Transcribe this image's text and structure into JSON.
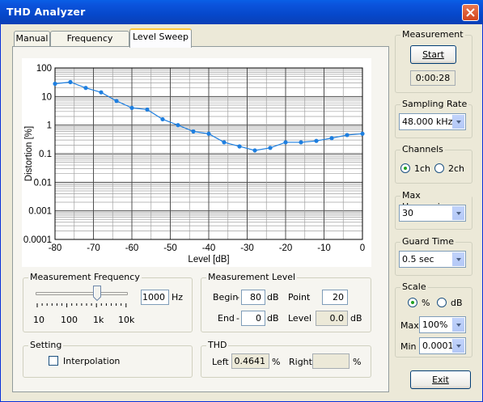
{
  "window": {
    "title": "THD Analyzer"
  },
  "tabs": [
    {
      "label": "Manual",
      "active": false
    },
    {
      "label": "Frequency Sweep",
      "active": false
    },
    {
      "label": "Level Sweep",
      "active": true
    }
  ],
  "chart_data": {
    "type": "line",
    "xlabel": "Level [dB]",
    "ylabel": "Distortion [%]",
    "xlim": [
      -80,
      0
    ],
    "ylim": [
      0.0001,
      100
    ],
    "yscale": "log",
    "grid": true,
    "x_ticks": [
      "-80",
      "-70",
      "-60",
      "-50",
      "-40",
      "-30",
      "-20",
      "-10",
      "0"
    ],
    "y_ticks": [
      "100",
      "10",
      "1",
      "0.1",
      "0.01",
      "0.001",
      "0.0001"
    ],
    "color": "#1e7fe0",
    "series": [
      {
        "x": [
          -80,
          -76,
          -72,
          -68,
          -64,
          -60,
          -56,
          -52,
          -48,
          -44,
          -40,
          -36,
          -32,
          -28,
          -24,
          -20,
          -16,
          -12,
          -8,
          -4,
          0
        ],
        "y": [
          28,
          32,
          20,
          14,
          7,
          4,
          3.5,
          1.6,
          1.0,
          0.6,
          0.5,
          0.25,
          0.18,
          0.13,
          0.16,
          0.25,
          0.25,
          0.28,
          0.35,
          0.45,
          0.5
        ]
      }
    ]
  },
  "measurement_frequency": {
    "label": "Measurement Frequency",
    "value": "1000",
    "unit": "Hz",
    "slider_ticks": [
      "10",
      "100",
      "1k",
      "10k"
    ]
  },
  "measurement_level": {
    "label": "Measurement Level",
    "begin_label": "Begin",
    "begin_value": "80",
    "end_label": "End",
    "end_value": "0",
    "db_unit": "dB",
    "point_label": "Point",
    "point_value": "20",
    "level_label": "Level",
    "level_value": "0.0",
    "level_unit": "dB",
    "minus": "-"
  },
  "setting": {
    "label": "Setting",
    "interpolation_label": "Interpolation",
    "interpolation_checked": false
  },
  "thd": {
    "label": "THD",
    "left_label": "Left",
    "left_value": "0.4641",
    "right_label": "Right",
    "right_value": "",
    "unit": "%"
  },
  "measurement": {
    "label": "Measurement",
    "start_label": "Start",
    "elapsed": "0:00:28"
  },
  "sampling_rate": {
    "label": "Sampling Rate",
    "value": "48.000 kHz"
  },
  "channels": {
    "label": "Channels",
    "options": [
      "1ch",
      "2ch"
    ],
    "selected": "1ch"
  },
  "max_harmonics": {
    "label": "Max Harmonics",
    "value": "30"
  },
  "guard_time": {
    "label": "Guard Time",
    "value": "0.5 sec"
  },
  "scale": {
    "label": "Scale",
    "options": [
      "%",
      "dB"
    ],
    "selected": "%",
    "max_label": "Max",
    "max_value": "100%",
    "min_label": "Min",
    "min_value": "0.0001:"
  },
  "exit_label": "Exit"
}
